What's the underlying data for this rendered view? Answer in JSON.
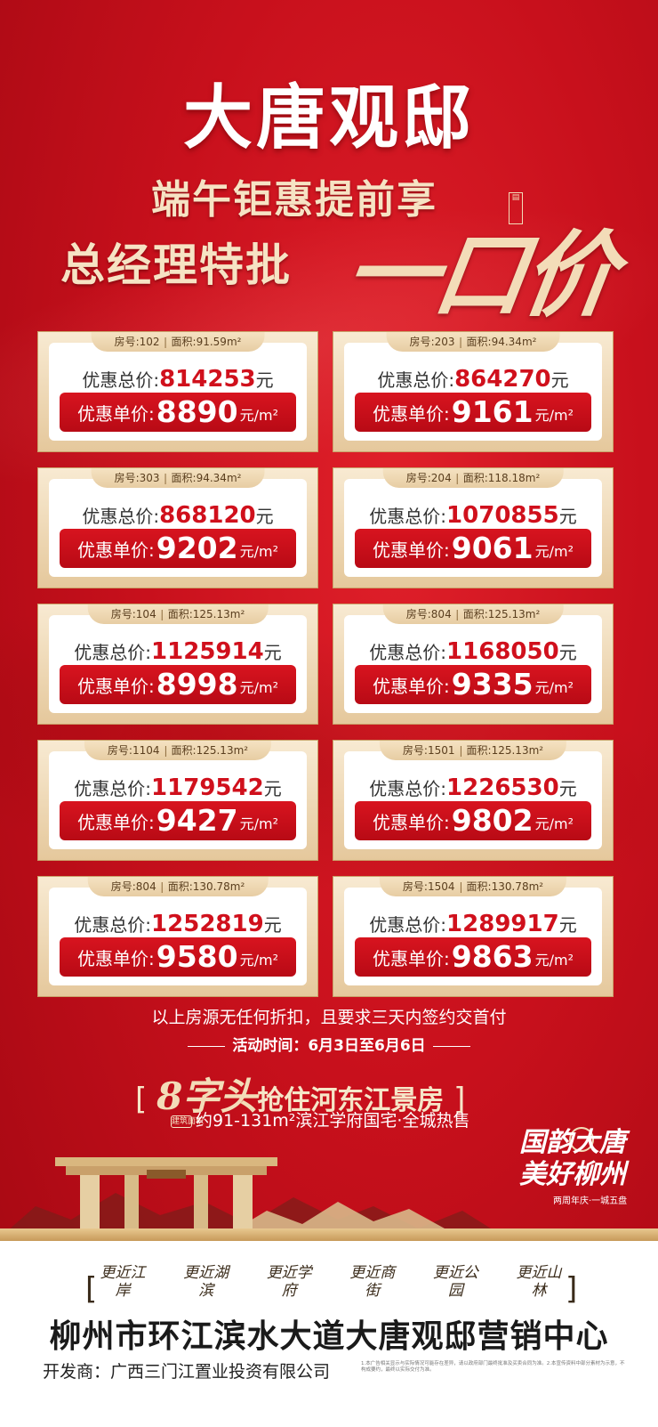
{
  "title": "大唐观邸",
  "subtitle1": "端午钜惠提前享",
  "subtitle2": "总经理特批",
  "brush_text": "一口价",
  "labels": {
    "room": "房号",
    "area": "面积",
    "total": "优惠总价:",
    "unit": "优惠单价:",
    "yuan": "元",
    "per_m2": "元/m²",
    "m2": "m²"
  },
  "cards": [
    {
      "room": "102",
      "area": "91.59",
      "total": "814253",
      "unit": "8890"
    },
    {
      "room": "203",
      "area": "94.34",
      "total": "864270",
      "unit": "9161"
    },
    {
      "room": "303",
      "area": "94.34",
      "total": "868120",
      "unit": "9202"
    },
    {
      "room": "204",
      "area": "118.18",
      "total": "1070855",
      "unit": "9061"
    },
    {
      "room": "104",
      "area": "125.13",
      "total": "1125914",
      "unit": "8998"
    },
    {
      "room": "804",
      "area": "125.13",
      "total": "1168050",
      "unit": "9335"
    },
    {
      "room": "1104",
      "area": "125.13",
      "total": "1179542",
      "unit": "9427"
    },
    {
      "room": "1501",
      "area": "125.13",
      "total": "1226530",
      "unit": "9802"
    },
    {
      "room": "804",
      "area": "130.78",
      "total": "1252819",
      "unit": "9580"
    },
    {
      "room": "1504",
      "area": "130.78",
      "total": "1289917",
      "unit": "9863"
    }
  ],
  "note": "以上房源无任何折扣，且要求三天内签约交首付",
  "event": "活动时间：6月3日至6月6日",
  "slogan_big": "8字头",
  "slogan": "抢住河东江景房",
  "area_badge": "建筑面积",
  "area_text": "约91-131m²滨江学府国宅·全城热售",
  "callig_line1": "国韵大唐",
  "callig_line2": "美好柳州",
  "callig_small": "两周年庆·一城五盘",
  "features": [
    "更近江岸",
    "更近湖滨",
    "更近学府",
    "更近商街",
    "更近公园",
    "更近山林"
  ],
  "address": "柳州市环江滨水大道大唐观邸营销中心",
  "developer": "开发商：广西三门江置业投资有限公司",
  "disclaimer": "1.本广告相关显示与实际情况可能存在差异，请以政府部门最终批准及买卖合同为准。2.本宣传资料中部分素材为示意，不构成要约，最终以实际交付为准。",
  "colors": {
    "red": "#d0101c",
    "gold": "#e5c89c"
  }
}
